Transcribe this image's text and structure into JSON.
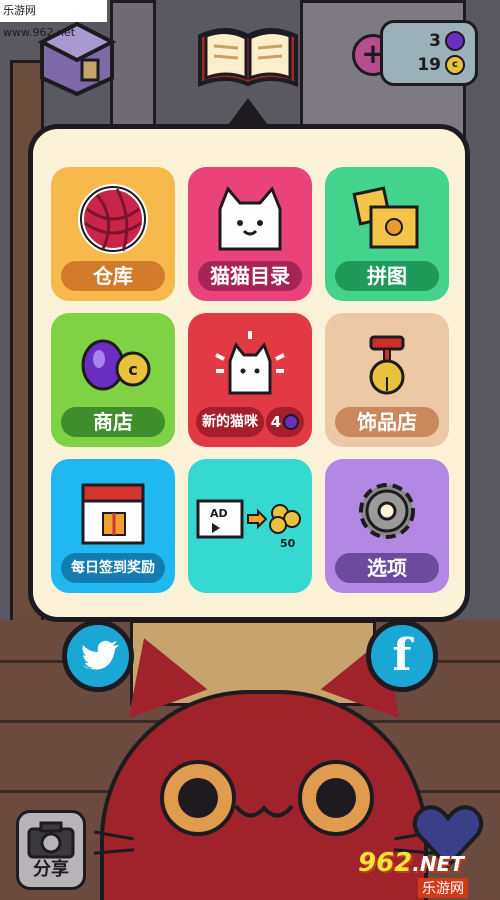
{
  "watermark": {
    "top_text": "乐游网 www.962.net",
    "logo_number": "962",
    "logo_suffix": ".NET",
    "logo_sub": "乐游网"
  },
  "currency": {
    "gems": "3",
    "coins": "19",
    "add_icon": "plus-icon"
  },
  "menu": {
    "tiles": [
      {
        "label": "仓库",
        "icon": "yarn-ball-icon",
        "bg": "#f7b94c",
        "label_bg": "#d27c2b"
      },
      {
        "label": "猫猫目录",
        "icon": "cat-catalog-icon",
        "bg": "#e9437a",
        "label_bg": "#a82457"
      },
      {
        "label": "拼图",
        "icon": "puzzle-icon",
        "bg": "#43d38d",
        "label_bg": "#1e9a5a"
      },
      {
        "label": "商店",
        "icon": "gem-coin-icon",
        "bg": "#7ed243",
        "label_bg": "#3f8d2b"
      },
      {
        "label": "新的猫咪",
        "badge": "4",
        "icon": "new-cat-icon",
        "bg": "#e23a44",
        "label_bg": "#a51e2a"
      },
      {
        "label": "饰品店",
        "icon": "collar-bell-icon",
        "bg": "#ecc8a5",
        "label_bg": "#c9895d"
      },
      {
        "label": "每日签到奖励",
        "icon": "calendar-gift-icon",
        "bg": "#20b8f0",
        "label_bg": "#137cb0"
      },
      {
        "label": "",
        "icon": "watch-ad-for-coins-icon",
        "ad_text": "AD",
        "reward": "50",
        "bg": "#35d9d1",
        "label_bg": ""
      },
      {
        "label": "选项",
        "icon": "gear-icon",
        "bg": "#b189e4",
        "label_bg": "#6c4a9e"
      }
    ]
  },
  "social": {
    "twitter_icon": "twitter-icon",
    "facebook_letter": "f"
  },
  "share": {
    "label": "分享",
    "icon": "camera-icon"
  }
}
